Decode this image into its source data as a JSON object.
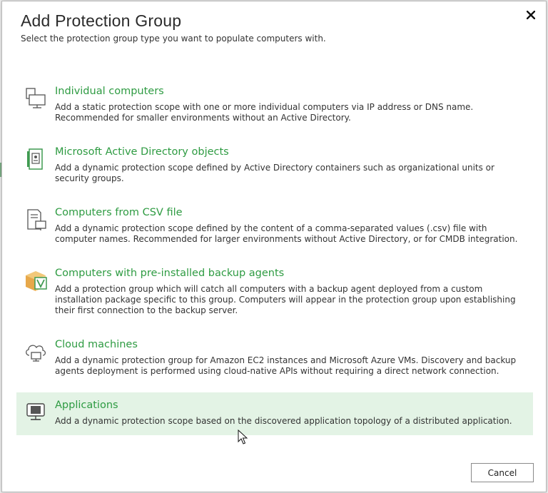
{
  "dialog": {
    "title": "Add Protection Group",
    "subtitle": "Select the protection group type you want to populate computers with.",
    "close_icon": "close-icon"
  },
  "options": [
    {
      "icon": "computer-icon",
      "title": "Individual computers",
      "description": "Add a static protection scope with one or more individual computers via IP address or DNS name. Recommended for smaller environments without an Active Directory."
    },
    {
      "icon": "active-directory-icon",
      "title": "Microsoft Active Directory objects",
      "description": "Add a dynamic protection scope defined by Active Directory containers such as organizational units or security groups."
    },
    {
      "icon": "csv-file-icon",
      "title": "Computers from CSV file",
      "description": "Add a dynamic protection scope defined by the content of a comma-separated values (.csv) file with computer names. Recommended for larger environments without Active Directory, or for CMDB integration."
    },
    {
      "icon": "backup-agent-package-icon",
      "title": "Computers with pre-installed backup agents",
      "description": "Add a protection group which will catch all computers with a backup agent deployed from a custom installation package specific to this group. Computers will appear in the protection group upon establishing their first connection to the backup server."
    },
    {
      "icon": "cloud-machine-icon",
      "title": "Cloud machines",
      "description": "Add a dynamic protection group for Amazon EC2 instances and Microsoft Azure VMs. Discovery and backup agents deployment is performed using cloud-native APIs without requiring a direct network connection."
    },
    {
      "icon": "application-icon",
      "title": "Applications",
      "description": "Add a dynamic protection scope based on the discovered application topology of a distributed application.",
      "selected": true
    }
  ],
  "buttons": {
    "cancel_label": "Cancel"
  },
  "colors": {
    "accent_green": "#2e9b42",
    "selected_background": "#e3f3e5"
  }
}
